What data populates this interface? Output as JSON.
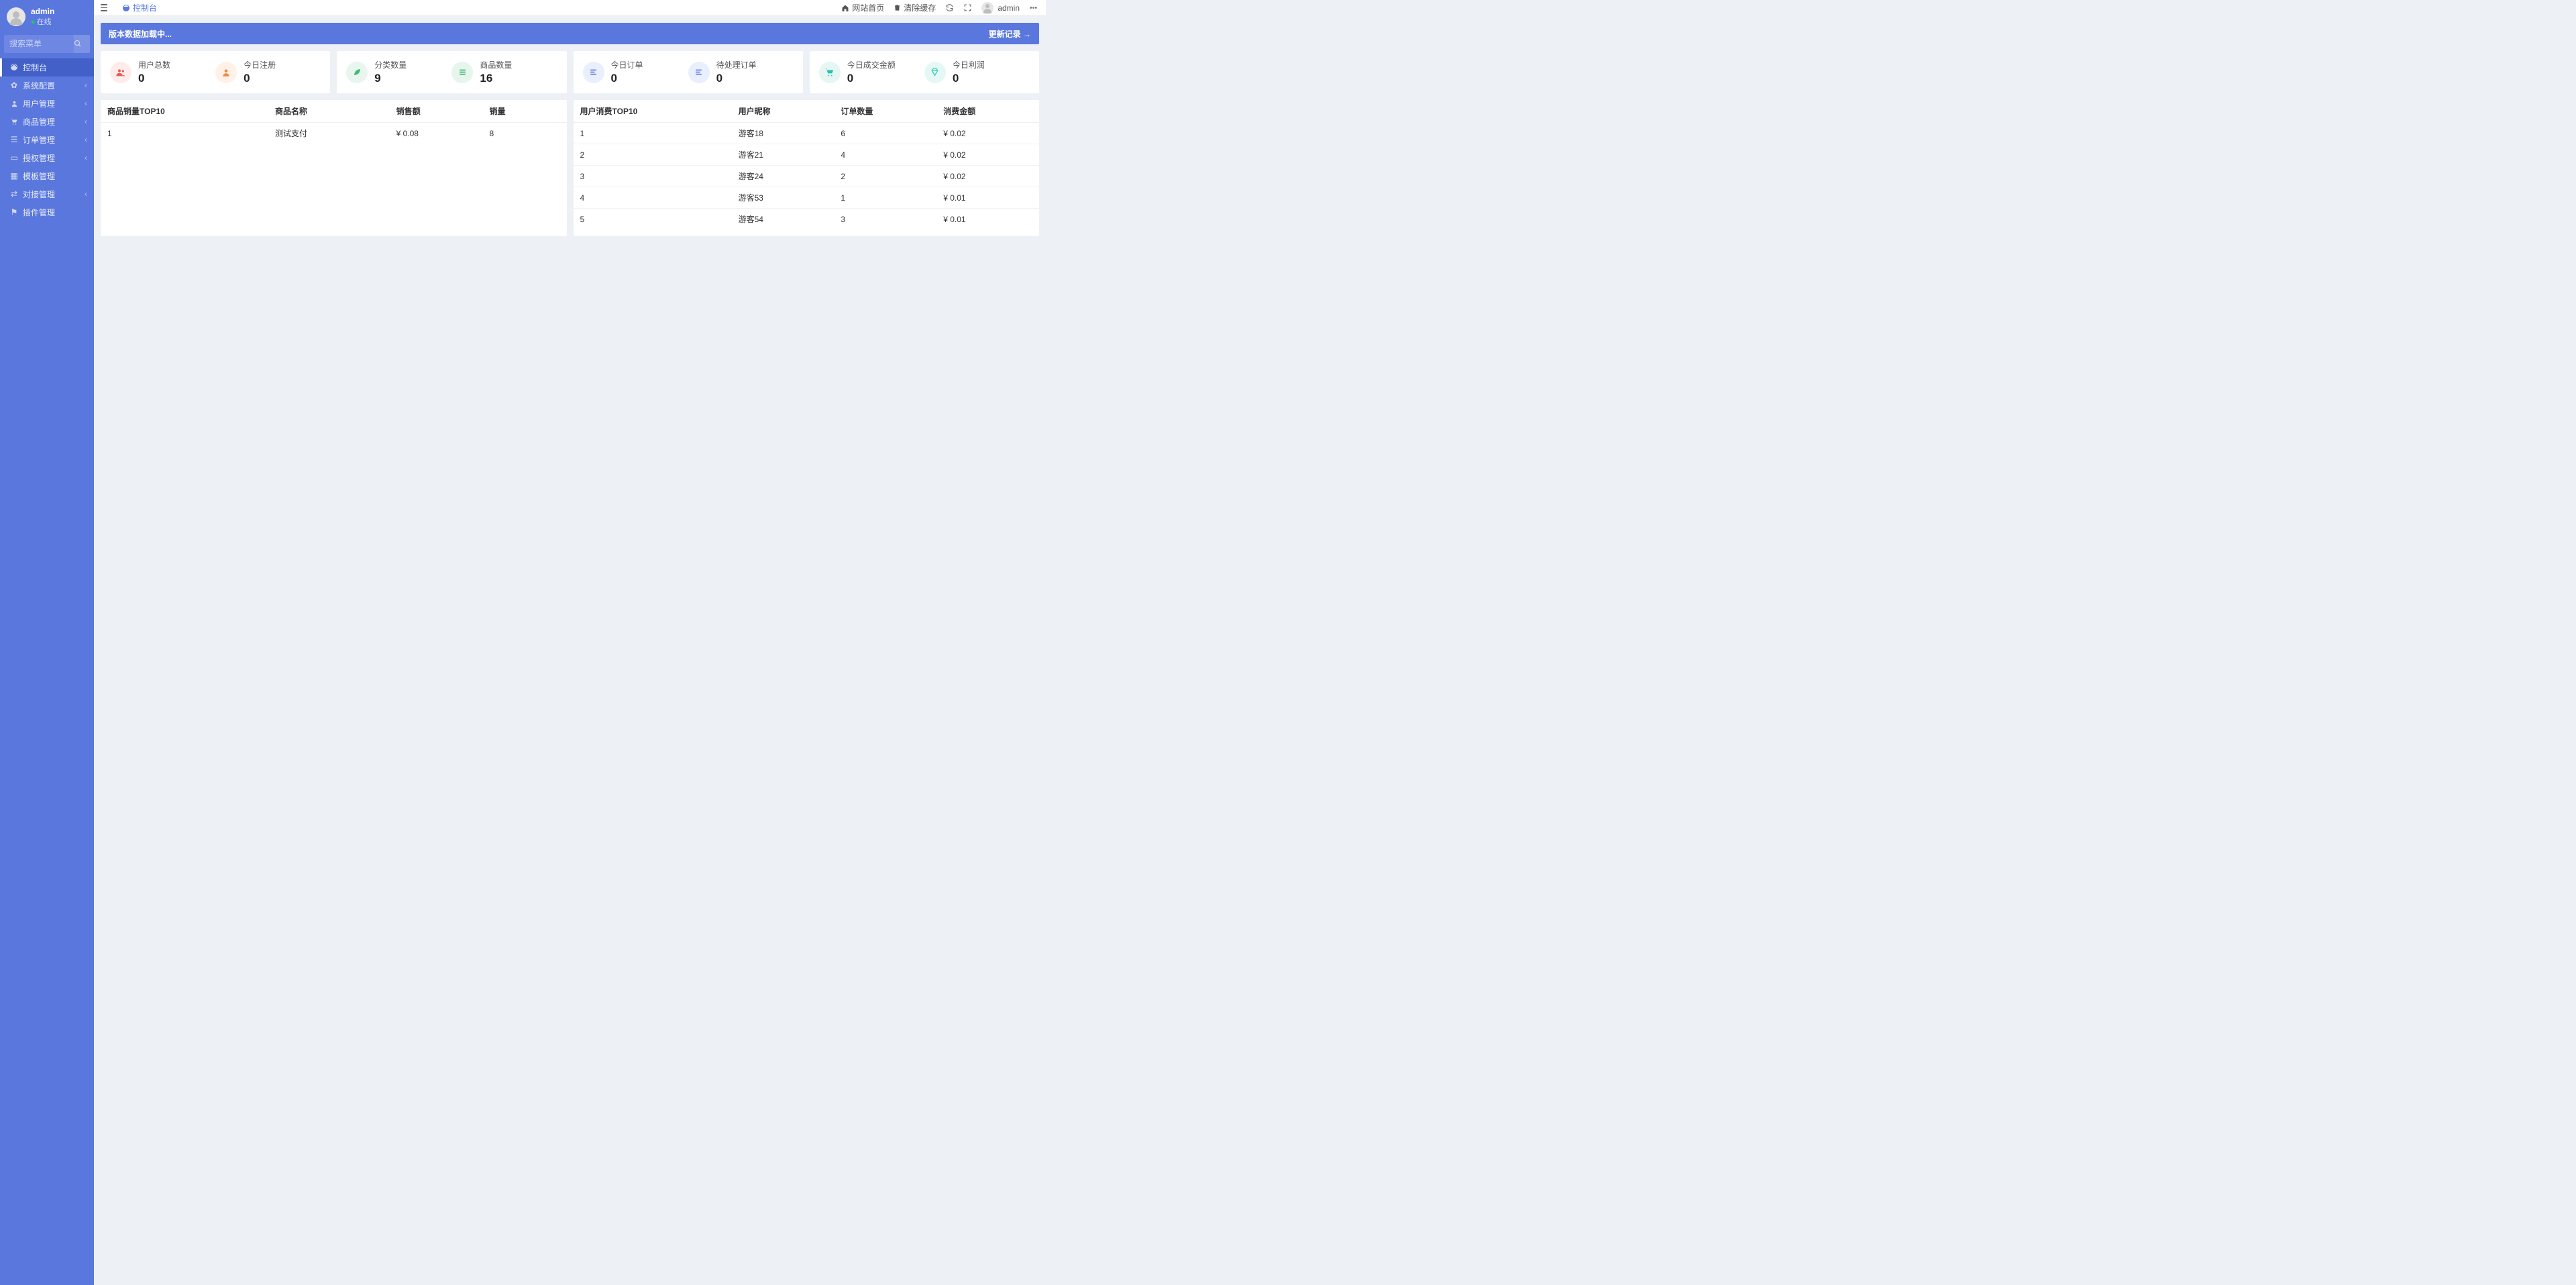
{
  "sidebar": {
    "username": "admin",
    "status": "在线",
    "search_placeholder": "搜索菜单",
    "items": [
      {
        "label": "控制台"
      },
      {
        "label": "系统配置"
      },
      {
        "label": "用户管理"
      },
      {
        "label": "商品管理"
      },
      {
        "label": "订单管理"
      },
      {
        "label": "授权管理"
      },
      {
        "label": "模板管理"
      },
      {
        "label": "对接管理"
      },
      {
        "label": "插件管理"
      }
    ]
  },
  "topbar": {
    "tab_label": "控制台",
    "home_label": "网站首页",
    "clear_cache_label": "清除缓存",
    "user_label": "admin"
  },
  "banner": {
    "loading_text": "版本数据加载中...",
    "link_text": "更新记录 →"
  },
  "stats": {
    "user_total": {
      "label": "用户总数",
      "value": "0"
    },
    "today_register": {
      "label": "今日注册",
      "value": "0"
    },
    "category_count": {
      "label": "分类数量",
      "value": "9"
    },
    "product_count": {
      "label": "商品数量",
      "value": "16"
    },
    "today_orders": {
      "label": "今日订单",
      "value": "0"
    },
    "pending_orders": {
      "label": "待处理订单",
      "value": "0"
    },
    "today_turnover": {
      "label": "今日成交金额",
      "value": "0"
    },
    "today_profit": {
      "label": "今日利润",
      "value": "0"
    }
  },
  "table_sales": {
    "title": "商品销量TOP10",
    "col_name": "商品名称",
    "col_amount": "销售额",
    "col_qty": "销量",
    "rows": [
      {
        "rank": "1",
        "name": "测试支付",
        "amount": "¥ 0.08",
        "qty": "8"
      }
    ]
  },
  "table_users": {
    "title": "用户消费TOP10",
    "col_nick": "用户昵称",
    "col_orders": "订单数量",
    "col_spend": "消费金额",
    "rows": [
      {
        "rank": "1",
        "nick": "游客18",
        "orders": "6",
        "spend": "¥ 0.02"
      },
      {
        "rank": "2",
        "nick": "游客21",
        "orders": "4",
        "spend": "¥ 0.02"
      },
      {
        "rank": "3",
        "nick": "游客24",
        "orders": "2",
        "spend": "¥ 0.02"
      },
      {
        "rank": "4",
        "nick": "游客53",
        "orders": "1",
        "spend": "¥ 0.01"
      },
      {
        "rank": "5",
        "nick": "游客54",
        "orders": "3",
        "spend": "¥ 0.01"
      }
    ]
  }
}
